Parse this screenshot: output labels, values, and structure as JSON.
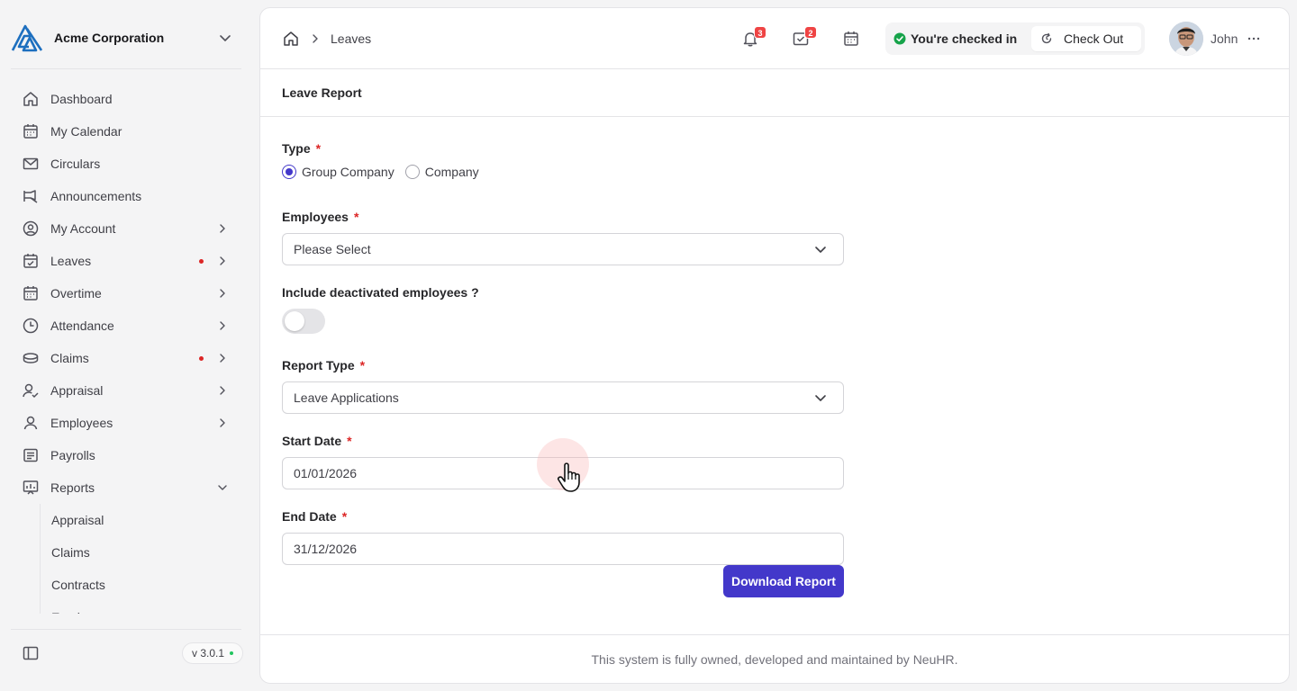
{
  "org": {
    "name": "Acme Corporation"
  },
  "nav": [
    {
      "label": "Dashboard"
    },
    {
      "label": "My Calendar"
    },
    {
      "label": "Circulars"
    },
    {
      "label": "Announcements"
    },
    {
      "label": "My Account"
    },
    {
      "label": "Leaves"
    },
    {
      "label": "Overtime"
    },
    {
      "label": "Attendance"
    },
    {
      "label": "Claims"
    },
    {
      "label": "Appraisal"
    },
    {
      "label": "Employees"
    },
    {
      "label": "Payrolls"
    },
    {
      "label": "Reports"
    }
  ],
  "reports_sub": [
    {
      "label": "Appraisal"
    },
    {
      "label": "Claims"
    },
    {
      "label": "Contracts"
    },
    {
      "label": "Employees"
    }
  ],
  "version": "v 3.0.1",
  "breadcrumb": {
    "current": "Leaves"
  },
  "topbar": {
    "notifications_count": "3",
    "approvals_count": "2",
    "checkin_status": "You're checked in",
    "checkout_label": "Check Out",
    "user_name": "John"
  },
  "page": {
    "title": "Leave Report"
  },
  "form": {
    "type_label": "Type",
    "type_options": [
      "Group Company",
      "Company"
    ],
    "type_selected": "Group Company",
    "employees_label": "Employees",
    "employees_placeholder": "Please Select",
    "include_deactivated_label": "Include deactivated employees ?",
    "include_deactivated": false,
    "report_type_label": "Report Type",
    "report_type_value": "Leave Applications",
    "start_date_label": "Start Date",
    "start_date_value": "01/01/2026",
    "end_date_label": "End Date",
    "end_date_value": "31/12/2026",
    "required_mark": "*",
    "download_label": "Download Report"
  },
  "footer": {
    "text": "This system is fully owned, developed and maintained by NeuHR."
  },
  "colors": {
    "accent": "#4338ca",
    "alert": "#ef4444",
    "success": "#16a34a"
  }
}
